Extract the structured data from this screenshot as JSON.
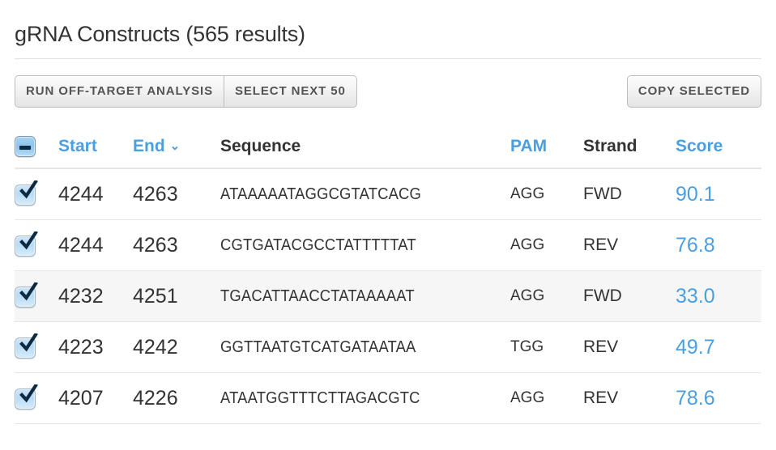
{
  "panel": {
    "title": "gRNA Constructs (565 results)"
  },
  "toolbar": {
    "run_off_target_label": "RUN OFF-TARGET ANALYSIS",
    "select_next_label": "SELECT NEXT 50",
    "copy_selected_label": "COPY SELECTED"
  },
  "table": {
    "select_all_state": "indeterminate",
    "sort_column": "End",
    "sort_direction": "desc",
    "sort_caret_glyph": "⌄",
    "columns": [
      {
        "key": "check",
        "label": "",
        "sortable": false
      },
      {
        "key": "start",
        "label": "Start",
        "sortable": true
      },
      {
        "key": "end",
        "label": "End",
        "sortable": true
      },
      {
        "key": "seq",
        "label": "Sequence",
        "sortable": false
      },
      {
        "key": "pam",
        "label": "PAM",
        "sortable": true
      },
      {
        "key": "strand",
        "label": "Strand",
        "sortable": false
      },
      {
        "key": "score",
        "label": "Score",
        "sortable": true
      }
    ],
    "rows": [
      {
        "selected": true,
        "start": "4244",
        "end": "4263",
        "sequence": "ATAAAAATAGGCGTATCACG",
        "pam": "AGG",
        "strand": "FWD",
        "score": "90.1"
      },
      {
        "selected": true,
        "start": "4244",
        "end": "4263",
        "sequence": "CGTGATACGCCTATTTTTAT",
        "pam": "AGG",
        "strand": "REV",
        "score": "76.8"
      },
      {
        "selected": true,
        "start": "4232",
        "end": "4251",
        "sequence": "TGACATTAACCTATAAAAAT",
        "pam": "AGG",
        "strand": "FWD",
        "score": "33.0"
      },
      {
        "selected": true,
        "start": "4223",
        "end": "4242",
        "sequence": "GGTTAATGTCATGATAATAA",
        "pam": "TGG",
        "strand": "REV",
        "score": "49.7"
      },
      {
        "selected": true,
        "start": "4207",
        "end": "4226",
        "sequence": "ATAATGGTTTCTTAGACGTC",
        "pam": "AGG",
        "strand": "REV",
        "score": "78.6"
      }
    ]
  },
  "colors": {
    "link_blue": "#4a9fe0",
    "text_dark": "#333333",
    "stripe": "#f6f6f6",
    "rule": "#e6e6e6",
    "checkbox_tick": "#0d2a43"
  }
}
